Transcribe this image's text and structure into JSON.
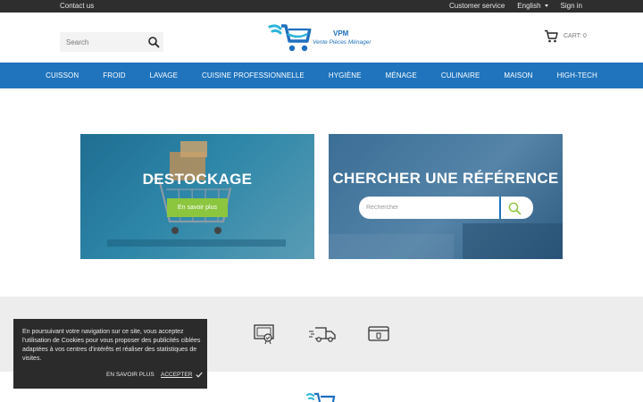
{
  "topbar": {
    "contact": "Contact us",
    "customer_service": "Customer service",
    "language": "English",
    "sign_in": "Sign in"
  },
  "header": {
    "search_placeholder": "Search",
    "logo_brand": "VPM",
    "logo_tagline": "Vente Pièces Ménager",
    "cart_label": "CART: 0"
  },
  "nav": {
    "items": [
      "CUISSON",
      "FROID",
      "LAVAGE",
      "CUISINE PROFESSIONNELLE",
      "HYGIÈNE",
      "MÉNAGE",
      "CULINAIRE",
      "MAISON",
      "HIGH-TECH"
    ]
  },
  "banners": {
    "destockage_title": "DESTOCKAGE",
    "destockage_button": "En savoir plus",
    "reference_title": "CHERCHER UNE RÉFÉRENCE",
    "reference_placeholder": "Rechercher"
  },
  "cookie": {
    "message": "En poursuivant votre navigation sur ce site, vous acceptez l'utilisation de Cookies pour vous proposer des publicités ciblées adaptées à vos centres d'intérêts et réaliser des statistiques de visites.",
    "more": "EN SAVOIR PLUS",
    "accept": "ACCEPTER"
  },
  "colors": {
    "nav_blue": "#1f74bd",
    "accent_green": "#8cc63f",
    "topbar_dark": "#2e2e2e"
  },
  "icons": [
    "search-icon",
    "cart-icon",
    "certificate-icon",
    "delivery-truck-icon",
    "secure-card-icon",
    "checkmark-icon",
    "caret-down-icon"
  ]
}
